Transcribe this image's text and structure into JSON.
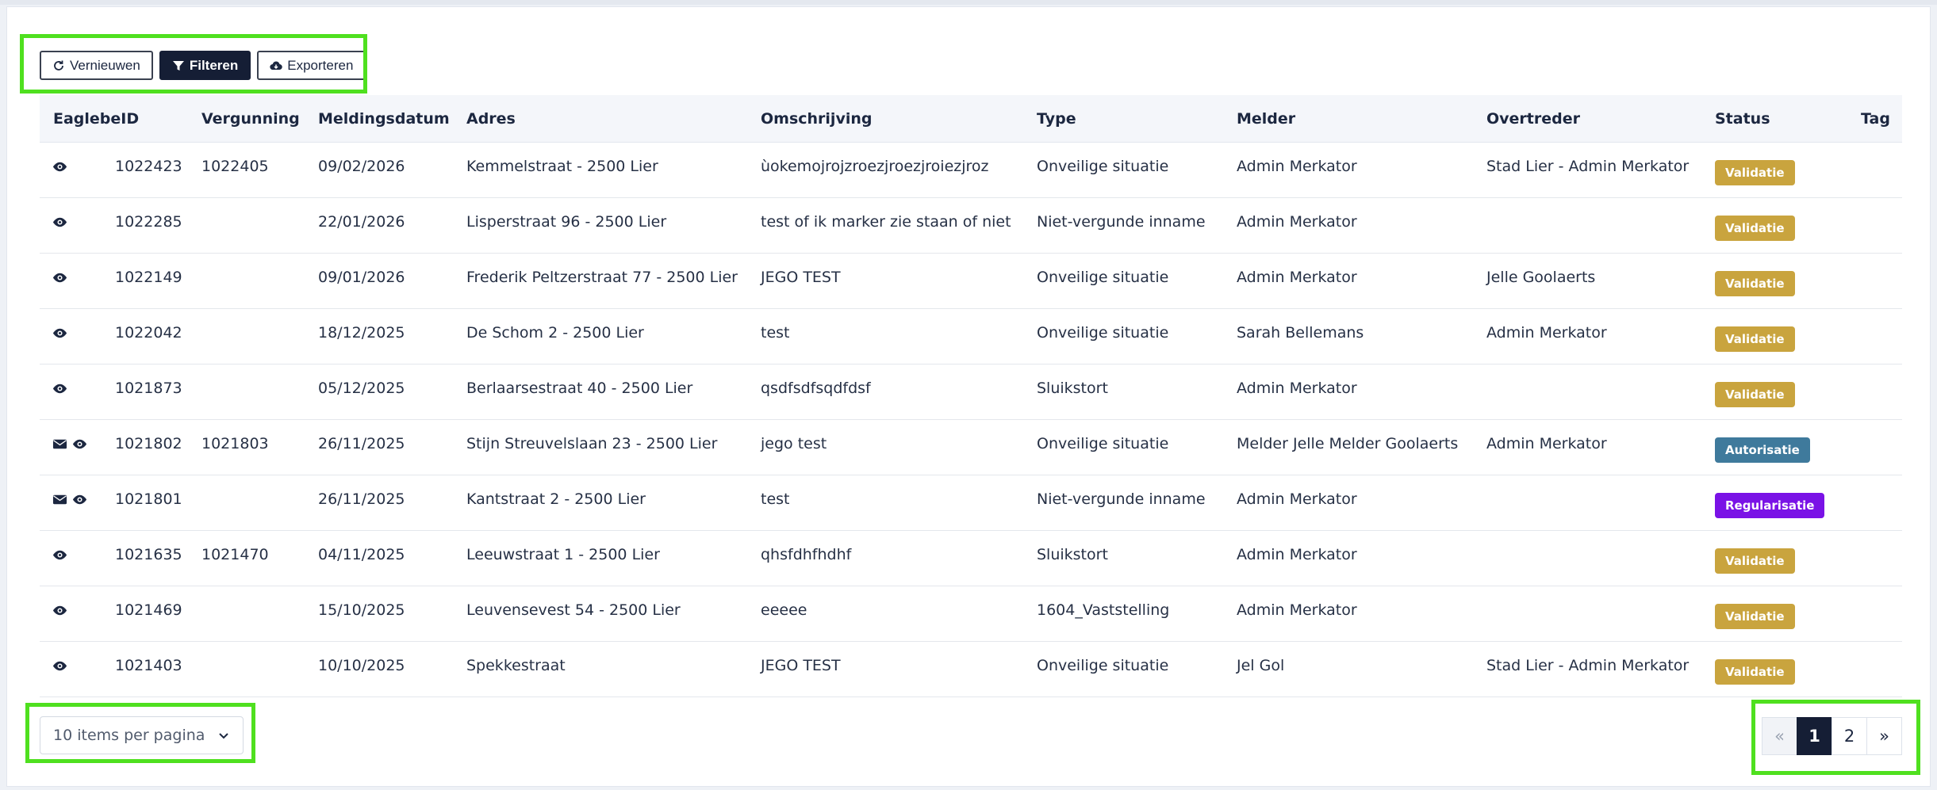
{
  "toolbar": {
    "refresh_label": "Vernieuwen",
    "filter_label": "Filteren",
    "export_label": "Exporteren"
  },
  "columns": [
    "EaglebeID",
    "Vergunning",
    "Meldingsdatum",
    "Adres",
    "Omschrijving",
    "Type",
    "Melder",
    "Overtreder",
    "Status",
    "Tag"
  ],
  "rows": [
    {
      "icons": [
        "eye-icon"
      ],
      "id": "1022423",
      "vergunning": "1022405",
      "datum": "09/02/2026",
      "adres": "Kemmelstraat - 2500 Lier",
      "omschrijving": "ùokemojrojzroezjroezjroiezjroz",
      "type": "Onveilige situatie",
      "melder": "Admin Merkator",
      "overtreder": "Stad Lier - Admin Merkator",
      "status": "Validatie",
      "status_color": "#c9a43e"
    },
    {
      "icons": [
        "eye-icon"
      ],
      "id": "1022285",
      "vergunning": "",
      "datum": "22/01/2026",
      "adres": "Lisperstraat 96 - 2500 Lier",
      "omschrijving": "test of ik marker zie staan of niet",
      "type": "Niet-vergunde inname",
      "melder": "Admin Merkator",
      "overtreder": "",
      "status": "Validatie",
      "status_color": "#c9a43e"
    },
    {
      "icons": [
        "eye-icon"
      ],
      "id": "1022149",
      "vergunning": "",
      "datum": "09/01/2026",
      "adres": "Frederik Peltzerstraat 77 - 2500 Lier",
      "omschrijving": "JEGO TEST",
      "type": "Onveilige situatie",
      "melder": "Admin Merkator",
      "overtreder": "Jelle Goolaerts",
      "status": "Validatie",
      "status_color": "#c9a43e"
    },
    {
      "icons": [
        "eye-icon"
      ],
      "id": "1022042",
      "vergunning": "",
      "datum": "18/12/2025",
      "adres": "De Schom 2 - 2500 Lier",
      "omschrijving": "test",
      "type": "Onveilige situatie",
      "melder": "Sarah Bellemans",
      "overtreder": "Admin Merkator",
      "status": "Validatie",
      "status_color": "#c9a43e"
    },
    {
      "icons": [
        "eye-icon"
      ],
      "id": "1021873",
      "vergunning": "",
      "datum": "05/12/2025",
      "adres": "Berlaarsestraat 40 - 2500 Lier",
      "omschrijving": "qsdfsdfsqdfdsf",
      "type": "Sluikstort",
      "melder": "Admin Merkator",
      "overtreder": "",
      "status": "Validatie",
      "status_color": "#c9a43e"
    },
    {
      "icons": [
        "envelope-icon",
        "eye-icon"
      ],
      "id": "1021802",
      "vergunning": "1021803",
      "datum": "26/11/2025",
      "adres": "Stijn Streuvelslaan 23 - 2500 Lier",
      "omschrijving": "jego test",
      "type": "Onveilige situatie",
      "melder": "Melder Jelle Melder Goolaerts",
      "overtreder": "Admin Merkator",
      "status": "Autorisatie",
      "status_color": "#3f7a9c"
    },
    {
      "icons": [
        "envelope-icon",
        "eye-icon"
      ],
      "id": "1021801",
      "vergunning": "",
      "datum": "26/11/2025",
      "adres": "Kantstraat 2 - 2500 Lier",
      "omschrijving": "test",
      "type": "Niet-vergunde inname",
      "melder": "Admin Merkator",
      "overtreder": "",
      "status": "Regularisatie",
      "status_color": "#7a12e6"
    },
    {
      "icons": [
        "eye-icon"
      ],
      "id": "1021635",
      "vergunning": "1021470",
      "datum": "04/11/2025",
      "adres": "Leeuwstraat 1 - 2500 Lier",
      "omschrijving": "qhsfdhfhdhf",
      "type": "Sluikstort",
      "melder": "Admin Merkator",
      "overtreder": "",
      "status": "Validatie",
      "status_color": "#c9a43e"
    },
    {
      "icons": [
        "eye-icon"
      ],
      "id": "1021469",
      "vergunning": "",
      "datum": "15/10/2025",
      "adres": "Leuvensevest 54 - 2500 Lier",
      "omschrijving": "eeeee",
      "type": "1604_Vaststelling",
      "melder": "Admin Merkator",
      "overtreder": "",
      "status": "Validatie",
      "status_color": "#c9a43e"
    },
    {
      "icons": [
        "eye-icon"
      ],
      "id": "1021403",
      "vergunning": "",
      "datum": "10/10/2025",
      "adres": "Spekkestraat",
      "omschrijving": "JEGO TEST",
      "type": "Onveilige situatie",
      "melder": "Jel Gol",
      "overtreder": "Stad Lier - Admin Merkator",
      "status": "Validatie",
      "status_color": "#c9a43e"
    }
  ],
  "per_page": {
    "selected": "10 items per pagina"
  },
  "pagination": {
    "prev": "«",
    "pages": [
      "1",
      "2"
    ],
    "current": "1",
    "next": "»"
  },
  "colors": {
    "highlight": "#4fe01f",
    "primary": "#151e35"
  }
}
